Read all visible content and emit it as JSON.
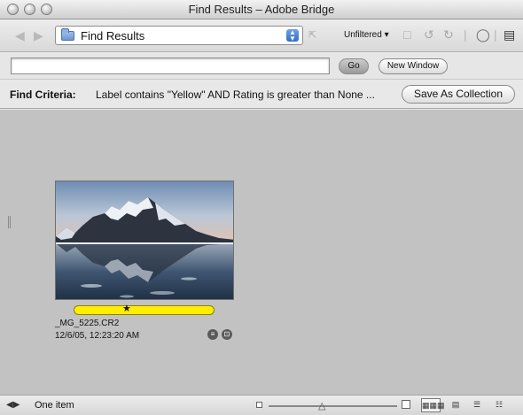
{
  "window": {
    "title": "Find Results – Adobe Bridge"
  },
  "toolbar": {
    "path_label": "Find Results",
    "filter_label": "Unfiltered",
    "icons": [
      "back-arrow-icon",
      "forward-arrow-icon",
      "folder-icon",
      "go-up-icon",
      "new-folder-icon",
      "rotate-left-icon",
      "rotate-right-icon",
      "trash-icon",
      "compact-mode-icon"
    ]
  },
  "search": {
    "value": "",
    "go_label": "Go",
    "new_window_label": "New Window"
  },
  "criteria": {
    "label": "Find Criteria:",
    "text": "Label contains \"Yellow\" AND Rating is greater than None ...",
    "save_label": "Save As Collection"
  },
  "items": [
    {
      "name": "_MG_5225.CR2",
      "date": "12/6/05, 12:23:20 AM",
      "rating_stars": 1,
      "label_color": "#ffee00",
      "badges": [
        "camera-raw-settings-icon",
        "crop-icon"
      ]
    }
  ],
  "status": {
    "text": "One item",
    "views": [
      "thumbnails-view-icon",
      "filmstrip-view-icon",
      "details-view-icon",
      "versions-view-icon"
    ]
  }
}
